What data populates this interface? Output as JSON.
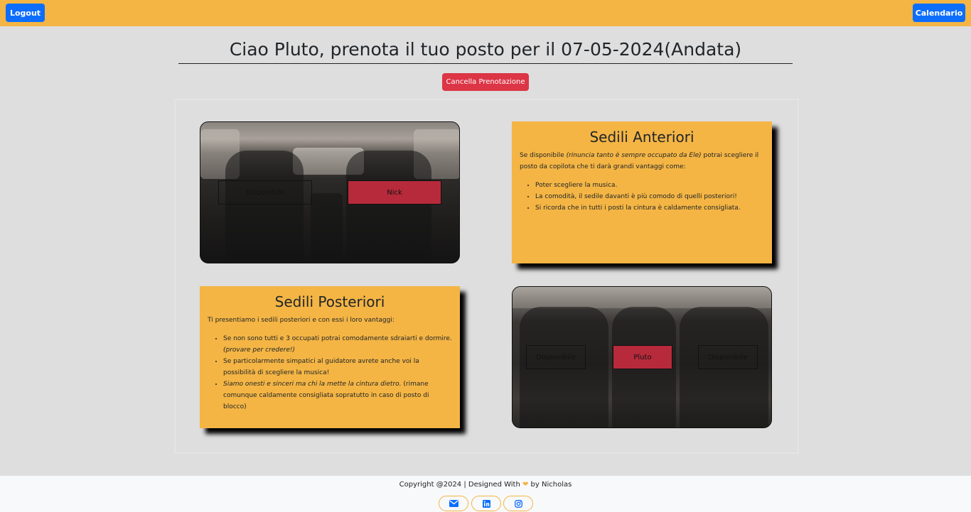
{
  "header": {
    "logout_label": "Logout",
    "calendar_label": "Calendario"
  },
  "page": {
    "title": "Ciao Pluto, prenota il tuo posto per il 07-05-2024(Andata)",
    "cancel_label": "Cancella Prenotazione"
  },
  "front": {
    "seats": [
      {
        "label": "Disponibile",
        "status": "free"
      },
      {
        "label": "Nick",
        "status": "taken"
      }
    ],
    "info": {
      "title": "Sedili Anteriori",
      "intro_before": "Se disponibile ",
      "intro_italic": "(rinuncia tanto è sempre occupato da Ele)",
      "intro_after": " potrai scegliere il posto da copilota che ti darà grandi vantaggi come:",
      "items": [
        "Poter scegliere la musica.",
        "La comodità, il sedile davanti è più comodo di quelli posteriori!",
        "Si ricorda che in tutti i posti la cintura è caldamente consigliata."
      ]
    }
  },
  "rear": {
    "seats": [
      {
        "label": "Disponibile",
        "status": "free"
      },
      {
        "label": "Pluto",
        "status": "taken"
      },
      {
        "label": "Disponibile",
        "status": "free"
      }
    ],
    "info": {
      "title": "Sedili Posteriori",
      "intro": "Ti presentiamo i sedili posteriori e con essi i loro vantaggi:",
      "item1_text": "Se non sono tutti e 3 occupati potrai comodamente sdraiarti e dormire. ",
      "item1_italic": "(provare per credere!)",
      "item2_text": "Se particolarmente simpatici al guidatore avrete anche voi la possibilità di scegliere la musica!",
      "item3_italic": "Siamo onesti e sinceri ma chi la mette la cintura dietro.",
      "item3_text": " (rimane comunque caldamente consigliata sopratutto in caso di posto di blocco)"
    }
  },
  "footer": {
    "copyright_before": "Copyright @2024 | Designed With ",
    "copyright_after": " by Nicholas",
    "icons": [
      "envelope-icon",
      "linkedin-icon",
      "instagram-icon"
    ]
  },
  "colors": {
    "accent": "#f4b544",
    "primary": "#0d6efd",
    "danger": "#dc3545",
    "taken": "#b72a3b",
    "background": "#dedede"
  }
}
